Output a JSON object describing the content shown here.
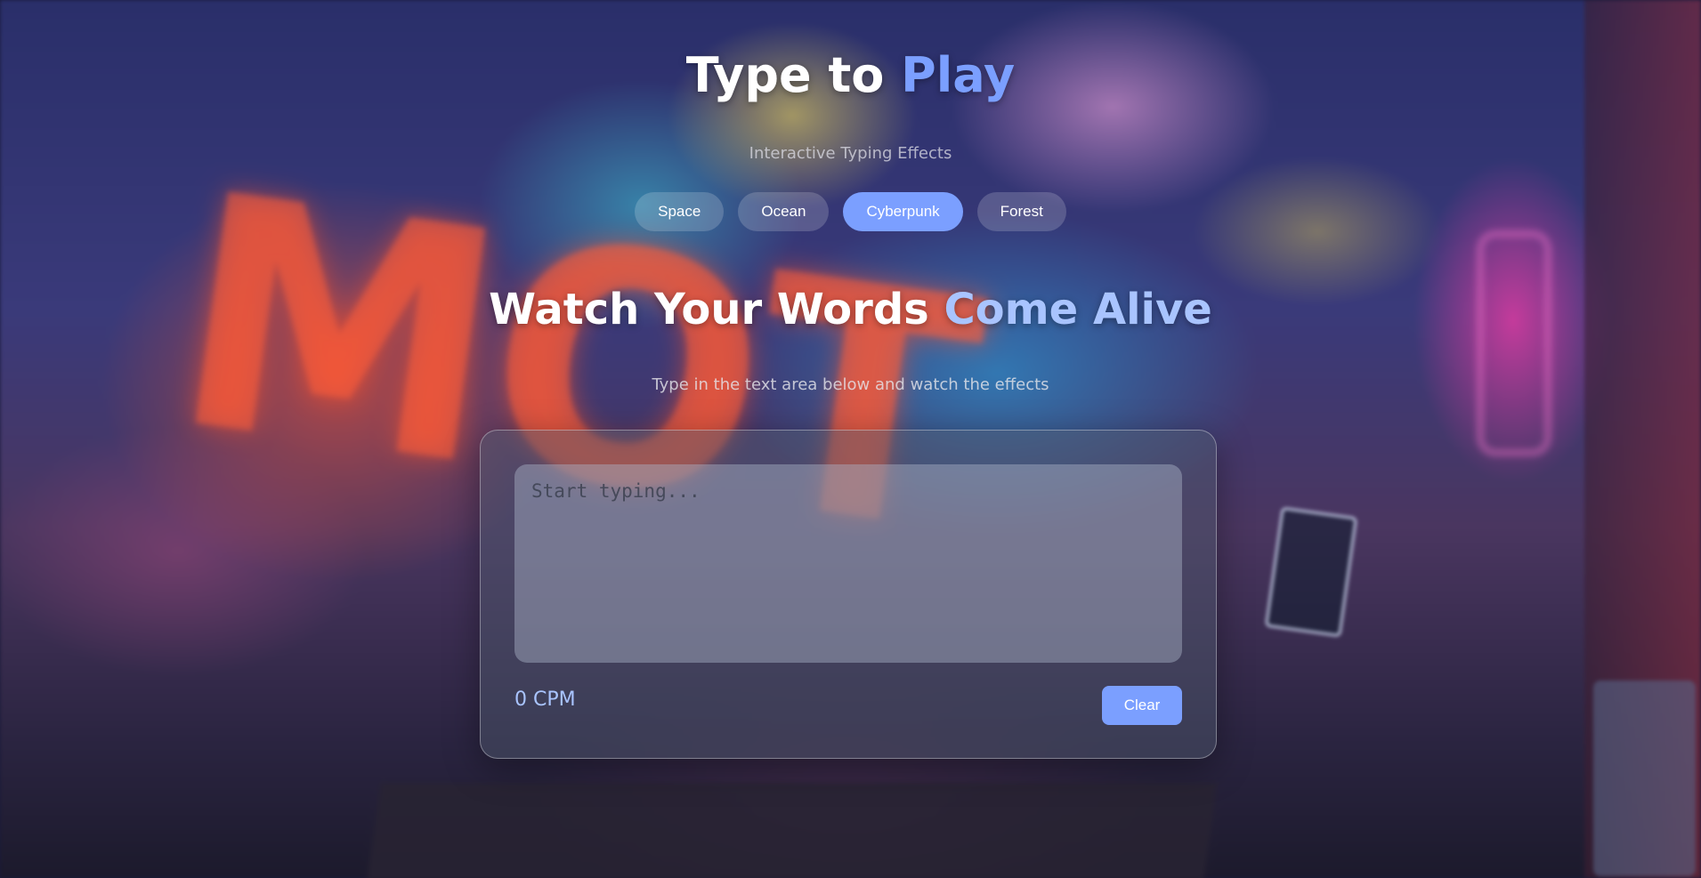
{
  "header": {
    "title_main": "Type to ",
    "title_accent": "Play",
    "subtitle": "Interactive Typing Effects"
  },
  "themes": {
    "items": [
      {
        "label": "Space",
        "active": false
      },
      {
        "label": "Ocean",
        "active": false
      },
      {
        "label": "Cyberpunk",
        "active": true
      },
      {
        "label": "Forest",
        "active": false
      }
    ]
  },
  "hero": {
    "heading_main": "Watch Your Words ",
    "heading_accent": "Come Alive",
    "lead": "Type in the text area below and watch the effects"
  },
  "editor": {
    "placeholder": "Start typing...",
    "value": "",
    "cpm_label": "0 CPM",
    "clear_label": "Clear"
  },
  "colors": {
    "accent": "#7b9fff",
    "accent_light": "#a9c4ff"
  }
}
